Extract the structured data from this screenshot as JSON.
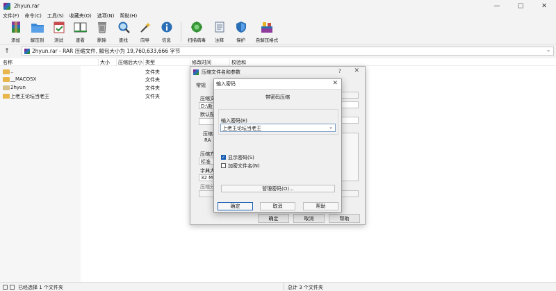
{
  "window": {
    "title": "2hyun.rar"
  },
  "menu": [
    "文件(F)",
    "命令(C)",
    "工具(S)",
    "收藏夹(O)",
    "选项(N)",
    "帮助(H)"
  ],
  "toolbar": [
    {
      "label": "添加",
      "icon": "add-archive-icon"
    },
    {
      "label": "解压到",
      "icon": "extract-to-icon"
    },
    {
      "label": "测试",
      "icon": "test-icon"
    },
    {
      "label": "查看",
      "icon": "view-icon"
    },
    {
      "label": "删除",
      "icon": "delete-icon"
    },
    {
      "label": "查找",
      "icon": "find-icon"
    },
    {
      "label": "向导",
      "icon": "wizard-icon"
    },
    {
      "label": "信息",
      "icon": "info-icon"
    },
    {
      "label": "扫描病毒",
      "icon": "virus-scan-icon"
    },
    {
      "label": "注释",
      "icon": "comment-icon"
    },
    {
      "label": "保护",
      "icon": "protect-icon"
    },
    {
      "label": "自解压格式",
      "icon": "sfx-icon"
    }
  ],
  "address": {
    "text": "2hyun.rar - RAR 压缩文件, 解包大小为 19,760,633,666 字节"
  },
  "columns": {
    "name": "名称",
    "size": "大小",
    "packed": "压缩后大小",
    "type": "类型",
    "modified": "修改时间",
    "crc": "校验和"
  },
  "files": [
    {
      "name": "..",
      "type": "文件夹"
    },
    {
      "name": "__MACOSX",
      "type": "文件夹"
    },
    {
      "name": "2hyun",
      "type": "文件夹"
    },
    {
      "name": "上老王论坛当老王",
      "type": "文件夹"
    }
  ],
  "status": {
    "left": "已经选择 1 个文件夹",
    "right": "总计 3 个文件夹"
  },
  "back_dialog": {
    "title": "压缩文件名和参数",
    "help": "?",
    "tab": "常规",
    "frag_archive": "压缩文",
    "frag_path": "D:\\新",
    "frag_default": "默认配",
    "frag_format": "压缩",
    "frag_radio": "RA",
    "frag_method": "压缩方",
    "frag_method_val": "标准",
    "frag_dict": "字典大",
    "frag_dict_val": "32 MB",
    "frag_split": "压缩分",
    "ok": "确定",
    "cancel": "取消",
    "help_btn": "帮助"
  },
  "front_dialog": {
    "title": "输入密码",
    "heading": "带密码压缩",
    "password_label": "输入密码(E)",
    "password_value": "上老王论坛当老王",
    "show_password": "显示密码(S)",
    "encrypt_names": "加密文件名(N)",
    "manage": "管理密码(O)...",
    "ok": "确定",
    "cancel": "取消",
    "help": "帮助"
  }
}
